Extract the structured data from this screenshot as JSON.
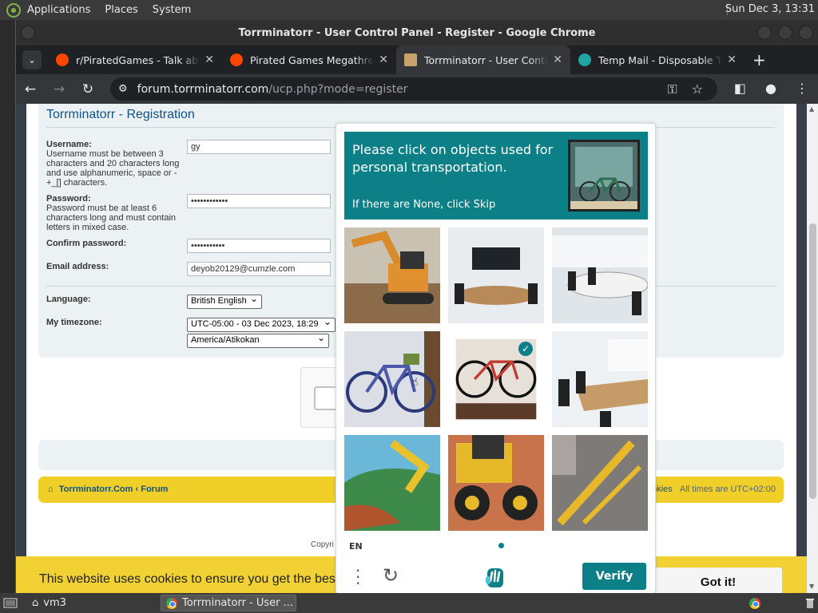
{
  "top_panel": {
    "menus": [
      "Applications",
      "Places",
      "System"
    ],
    "clock": "Sun Dec  3, 13:31"
  },
  "window": {
    "title": "Torrminatorr - User Control Panel - Register - Google Chrome"
  },
  "tabs": [
    {
      "label": "r/PiratedGames - Talk abo",
      "favicon_color": "#ff4500",
      "active": false
    },
    {
      "label": "Pirated Games Megathre",
      "favicon_color": "#ff4500",
      "active": false
    },
    {
      "label": "Torrminatorr - User Contr",
      "favicon_color": "#c9a36b",
      "active": true
    },
    {
      "label": "Temp Mail - Disposable Te",
      "favicon_color": "#1fa3a3",
      "active": false
    }
  ],
  "address_bar": {
    "host": "forum.torrminatorr.com",
    "path": "/ucp.php?mode=register"
  },
  "form": {
    "heading": "Torrminatorr - Registration",
    "username": {
      "label": "Username:",
      "hint": "Username must be between 3 characters and 20 characters long and use alphanumeric, space or -+_[] characters.",
      "value": "gy"
    },
    "password": {
      "label": "Password:",
      "hint": "Password must be at least 6 characters long and must contain letters in mixed case.",
      "value": "••••••••••••"
    },
    "confirm_password": {
      "label": "Confirm password:",
      "value": "•••••••••••"
    },
    "email": {
      "label": "Email address:",
      "value": "deyob20129@cumzle.com"
    },
    "language": {
      "label": "Language:",
      "value": "British English"
    },
    "timezone": {
      "label": "My timezone:",
      "offset_value": "UTC-05:00 - 03 Dec 2023, 18:29",
      "zone_value": "America/Atikokan"
    }
  },
  "footer_nav": {
    "home": "Torrminatorr.Com",
    "forum": "Forum",
    "cookies": "okies",
    "times": "All times are UTC+02:00"
  },
  "copyright": "Copyri",
  "cookie_bar": {
    "message": "This website uses cookies to ensure you get the bes",
    "button": "Got it!"
  },
  "challenge": {
    "prompt": "Please click on objects used for personal transportation.",
    "sub": "If there are None, click Skip",
    "tiles": [
      {
        "name": "excavator",
        "selected": false
      },
      {
        "name": "conference-room",
        "selected": false
      },
      {
        "name": "conference-room",
        "selected": false
      },
      {
        "name": "bicycle",
        "selected": false
      },
      {
        "name": "bicycle",
        "selected": true
      },
      {
        "name": "conference-room",
        "selected": false
      },
      {
        "name": "excavator",
        "selected": false
      },
      {
        "name": "loader",
        "selected": false
      },
      {
        "name": "crane",
        "selected": false
      }
    ],
    "language": "EN",
    "verify": "Verify",
    "accent": "#0d7f87"
  },
  "taskbar": {
    "workspace": "vm3",
    "active_task": "Torrminatorr - User ..."
  }
}
